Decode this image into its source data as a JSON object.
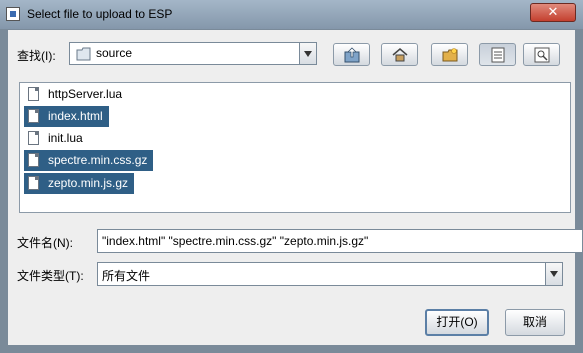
{
  "window": {
    "title": "Select file to upload to ESP"
  },
  "lookin": {
    "label": "查找(I):",
    "value": "source",
    "folder_icon": "folder-icon"
  },
  "toolbar": {
    "icons": [
      "up-folder-icon",
      "home-icon",
      "new-folder-icon",
      "list-view-icon",
      "details-view-icon"
    ]
  },
  "files": [
    {
      "name": "httpServer.lua",
      "selected": false
    },
    {
      "name": "index.html",
      "selected": true
    },
    {
      "name": "init.lua",
      "selected": false
    },
    {
      "name": "spectre.min.css.gz",
      "selected": true
    },
    {
      "name": "zepto.min.js.gz",
      "selected": true
    }
  ],
  "filename": {
    "label": "文件名(N):",
    "value": "\"index.html\" \"spectre.min.css.gz\" \"zepto.min.js.gz\""
  },
  "filetype": {
    "label": "文件类型(T):",
    "value": "所有文件"
  },
  "buttons": {
    "open": "打开(O)",
    "cancel": "取消"
  },
  "colors": {
    "selection": "#2f5f86",
    "titlebar": "#8fa2b6"
  }
}
